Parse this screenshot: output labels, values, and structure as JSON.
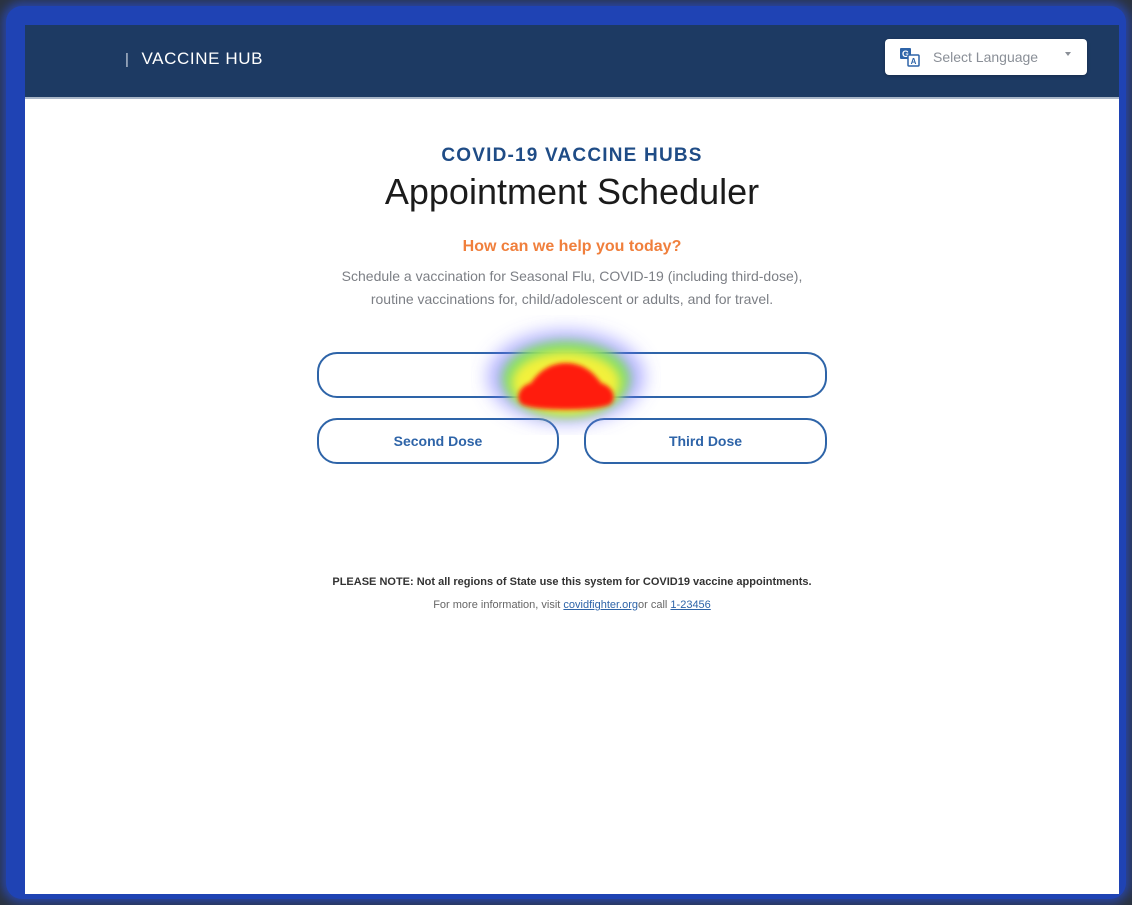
{
  "header": {
    "divider": "|",
    "brand": "VACCINE HUB",
    "language_select": {
      "icon": "translate-icon",
      "placeholder": "Select Language"
    }
  },
  "main": {
    "kicker": "COVID-19 VACCINE HUBS",
    "title": "Appointment Scheduler",
    "question": "How can we help you today?",
    "description_line1": "Schedule a vaccination for Seasonal Flu, COVID-19 (including third-dose),",
    "description_line2": "routine vaccinations for, child/adolescent or adults, and for travel.",
    "buttons": {
      "first": "",
      "second": "Second Dose",
      "third": "Third Dose"
    }
  },
  "footer": {
    "note": "PLEASE NOTE: Not all regions of State use this system for COVID19 vaccine appointments.",
    "info_prefix": "For more information, visit ",
    "info_link": "covidfighter.org",
    "info_middle": "or call ",
    "info_phone": "1-23456"
  },
  "colors": {
    "header_bg": "#1d3a63",
    "accent_blue": "#2e64a8",
    "accent_orange": "#f07f3c"
  }
}
